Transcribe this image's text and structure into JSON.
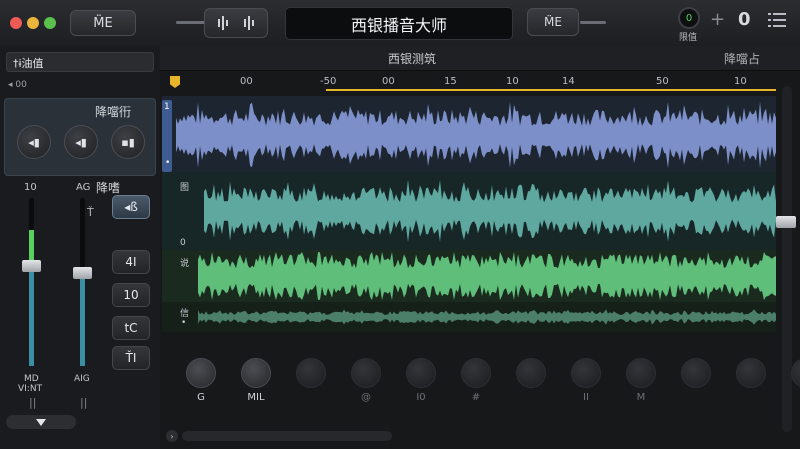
{
  "titlebar": {
    "left_button_label": "M̈E",
    "lcd_title": "西银播音大师",
    "right_button_label": "M̈E",
    "meter_value": "0",
    "meter_label": "限值",
    "plus_label": "+",
    "count_value": "0"
  },
  "sidebar": {
    "preset_label": "†ɨ油值",
    "sub_label": "◂ 00",
    "section1_title": "降噹衎",
    "fader_left_top": "10",
    "fader_right_top": "AG",
    "section2_title": "降嗜",
    "buttons": [
      "4I",
      "10",
      "tC",
      "ŤI"
    ],
    "fader_left_bottom_1": "MD",
    "fader_left_bottom_2": "VI:NT",
    "fader_right_bottom": "AIG"
  },
  "editor": {
    "header_title": "西银测筑",
    "header_right": "降噹占",
    "ruler_ticks": [
      "00",
      "-50",
      "00",
      "15",
      "10",
      "14",
      "50",
      "10"
    ],
    "tracks": [
      {
        "label": "1",
        "sublabel": "•",
        "color": "#7d8fc8"
      },
      {
        "label": "图",
        "sublabel": "0",
        "color": "#5fa8a0"
      },
      {
        "label": "说",
        "sublabel": "",
        "color": "#5fbf7a"
      },
      {
        "label": "信",
        "sublabel": "•",
        "color": "#4b7f6a"
      }
    ]
  },
  "bottom_controls": {
    "knobs": [
      "G",
      "MIL",
      "",
      "@",
      "I0",
      "#",
      "",
      "II",
      "M",
      "",
      "",
      ""
    ]
  },
  "colors": {
    "accent_yellow": "#e6b52a",
    "track1": "#7d8fc8",
    "track2": "#5fa8a0",
    "track3": "#5fbf7a",
    "fader_green": "#58d060"
  }
}
